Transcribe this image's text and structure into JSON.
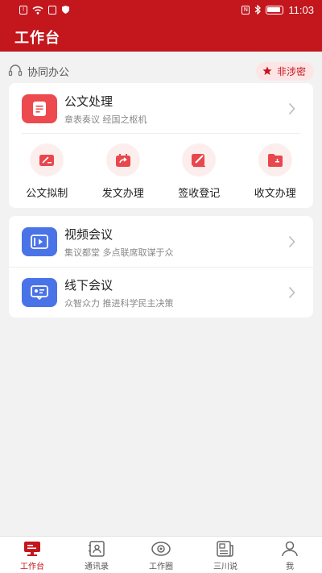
{
  "status_bar": {
    "time": "11:03"
  },
  "header": {
    "title": "工作台"
  },
  "section": {
    "title": "协同办公",
    "badge": "非涉密"
  },
  "card1": {
    "title": "公文处理",
    "subtitle": "章表奏议 经国之枢机",
    "actions": [
      {
        "label": "公文拟制",
        "icon": "draft-icon"
      },
      {
        "label": "发文办理",
        "icon": "send-doc-icon"
      },
      {
        "label": "签收登记",
        "icon": "sign-icon"
      },
      {
        "label": "收文办理",
        "icon": "receive-doc-icon"
      }
    ]
  },
  "card2": {
    "rows": [
      {
        "title": "视频会议",
        "subtitle": "集议都堂 多点联席取谋于众",
        "icon": "video-meeting-icon"
      },
      {
        "title": "线下会议",
        "subtitle": "众智众力 推进科学民主决策",
        "icon": "offline-meeting-icon"
      }
    ]
  },
  "tabbar": {
    "items": [
      {
        "label": "工作台",
        "icon": "workbench-icon",
        "active": true
      },
      {
        "label": "通讯录",
        "icon": "contacts-icon",
        "active": false
      },
      {
        "label": "工作圈",
        "icon": "work-circle-icon",
        "active": false
      },
      {
        "label": "三川说",
        "icon": "news-icon",
        "active": false
      },
      {
        "label": "我",
        "icon": "profile-icon",
        "active": false
      }
    ]
  },
  "colors": {
    "brand": "#c3161d",
    "accent_light": "#fdeeee",
    "blue_icon": "#4a73e8"
  }
}
